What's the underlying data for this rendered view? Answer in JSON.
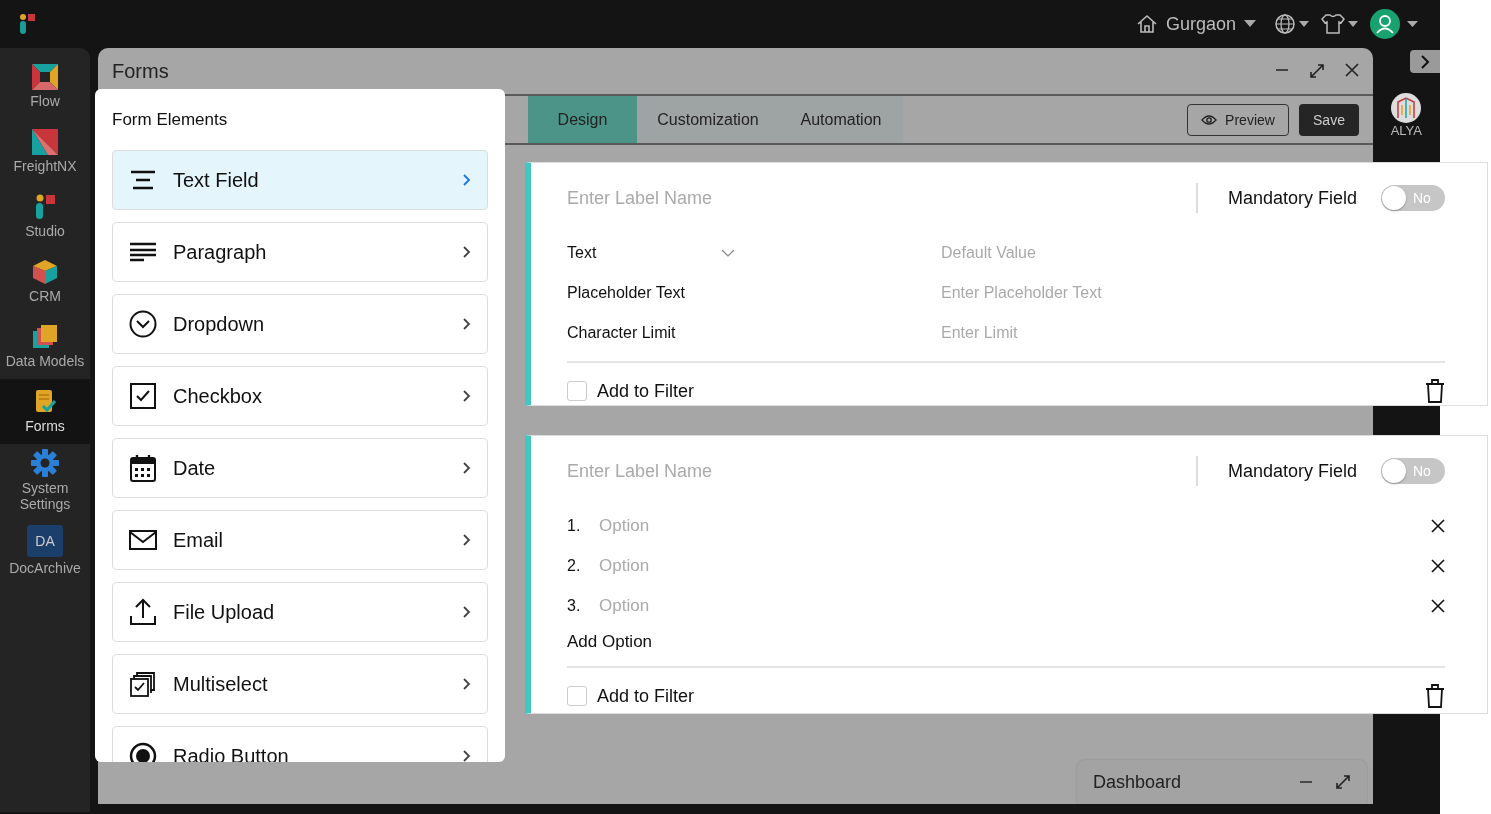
{
  "app_bar": {
    "location": "Gurgaon"
  },
  "sidebar": {
    "items": [
      {
        "label": "Flow",
        "selected": false
      },
      {
        "label": "FreightNX",
        "selected": false
      },
      {
        "label": "Studio",
        "selected": false
      },
      {
        "label": "CRM",
        "selected": false
      },
      {
        "label": "Data Models",
        "selected": false
      },
      {
        "label": "Forms",
        "selected": true
      },
      {
        "label": "System Settings",
        "selected": false
      },
      {
        "label": "DocArchive",
        "badge": "DA",
        "selected": false
      }
    ]
  },
  "window": {
    "title": "Forms",
    "tabs": [
      {
        "label": "Design",
        "selected": true
      },
      {
        "label": "Customization",
        "selected": false
      },
      {
        "label": "Automation",
        "selected": false
      }
    ],
    "preview_button": "Preview",
    "save_button": "Save"
  },
  "assistant": {
    "label": "ALYA"
  },
  "form_elements": {
    "title": "Form Elements",
    "items": [
      {
        "label": "Text Field",
        "selected": true
      },
      {
        "label": "Paragraph",
        "selected": false
      },
      {
        "label": "Dropdown",
        "selected": false
      },
      {
        "label": "Checkbox",
        "selected": false
      },
      {
        "label": "Date",
        "selected": false
      },
      {
        "label": "Email",
        "selected": false
      },
      {
        "label": "File Upload",
        "selected": false
      },
      {
        "label": "Multiselect",
        "selected": false
      },
      {
        "label": "Radio Button",
        "selected": false
      }
    ]
  },
  "cards": [
    {
      "kind": "text",
      "label_placeholder": "Enter Label Name",
      "mandatory_label": "Mandatory Field",
      "mandatory": {
        "on": false,
        "text": "No"
      },
      "type": "Text",
      "default_placeholder": "Default Value",
      "rows": [
        {
          "label": "Placeholder Text",
          "placeholder": "Enter Placeholder Text"
        },
        {
          "label": "Character Limit",
          "placeholder": "Enter Limit"
        }
      ],
      "filter_label": "Add to Filter",
      "filter_checked": false
    },
    {
      "kind": "options",
      "label_placeholder": "Enter Label Name",
      "mandatory_label": "Mandatory Field",
      "mandatory": {
        "on": false,
        "text": "No"
      },
      "options": [
        {
          "number": "1.",
          "placeholder": "Option"
        },
        {
          "number": "2.",
          "placeholder": "Option"
        },
        {
          "number": "3.",
          "placeholder": "Option"
        }
      ],
      "add_option": "Add Option",
      "filter_label": "Add to Filter",
      "filter_checked": false
    }
  ],
  "dashboard": {
    "title": "Dashboard"
  }
}
